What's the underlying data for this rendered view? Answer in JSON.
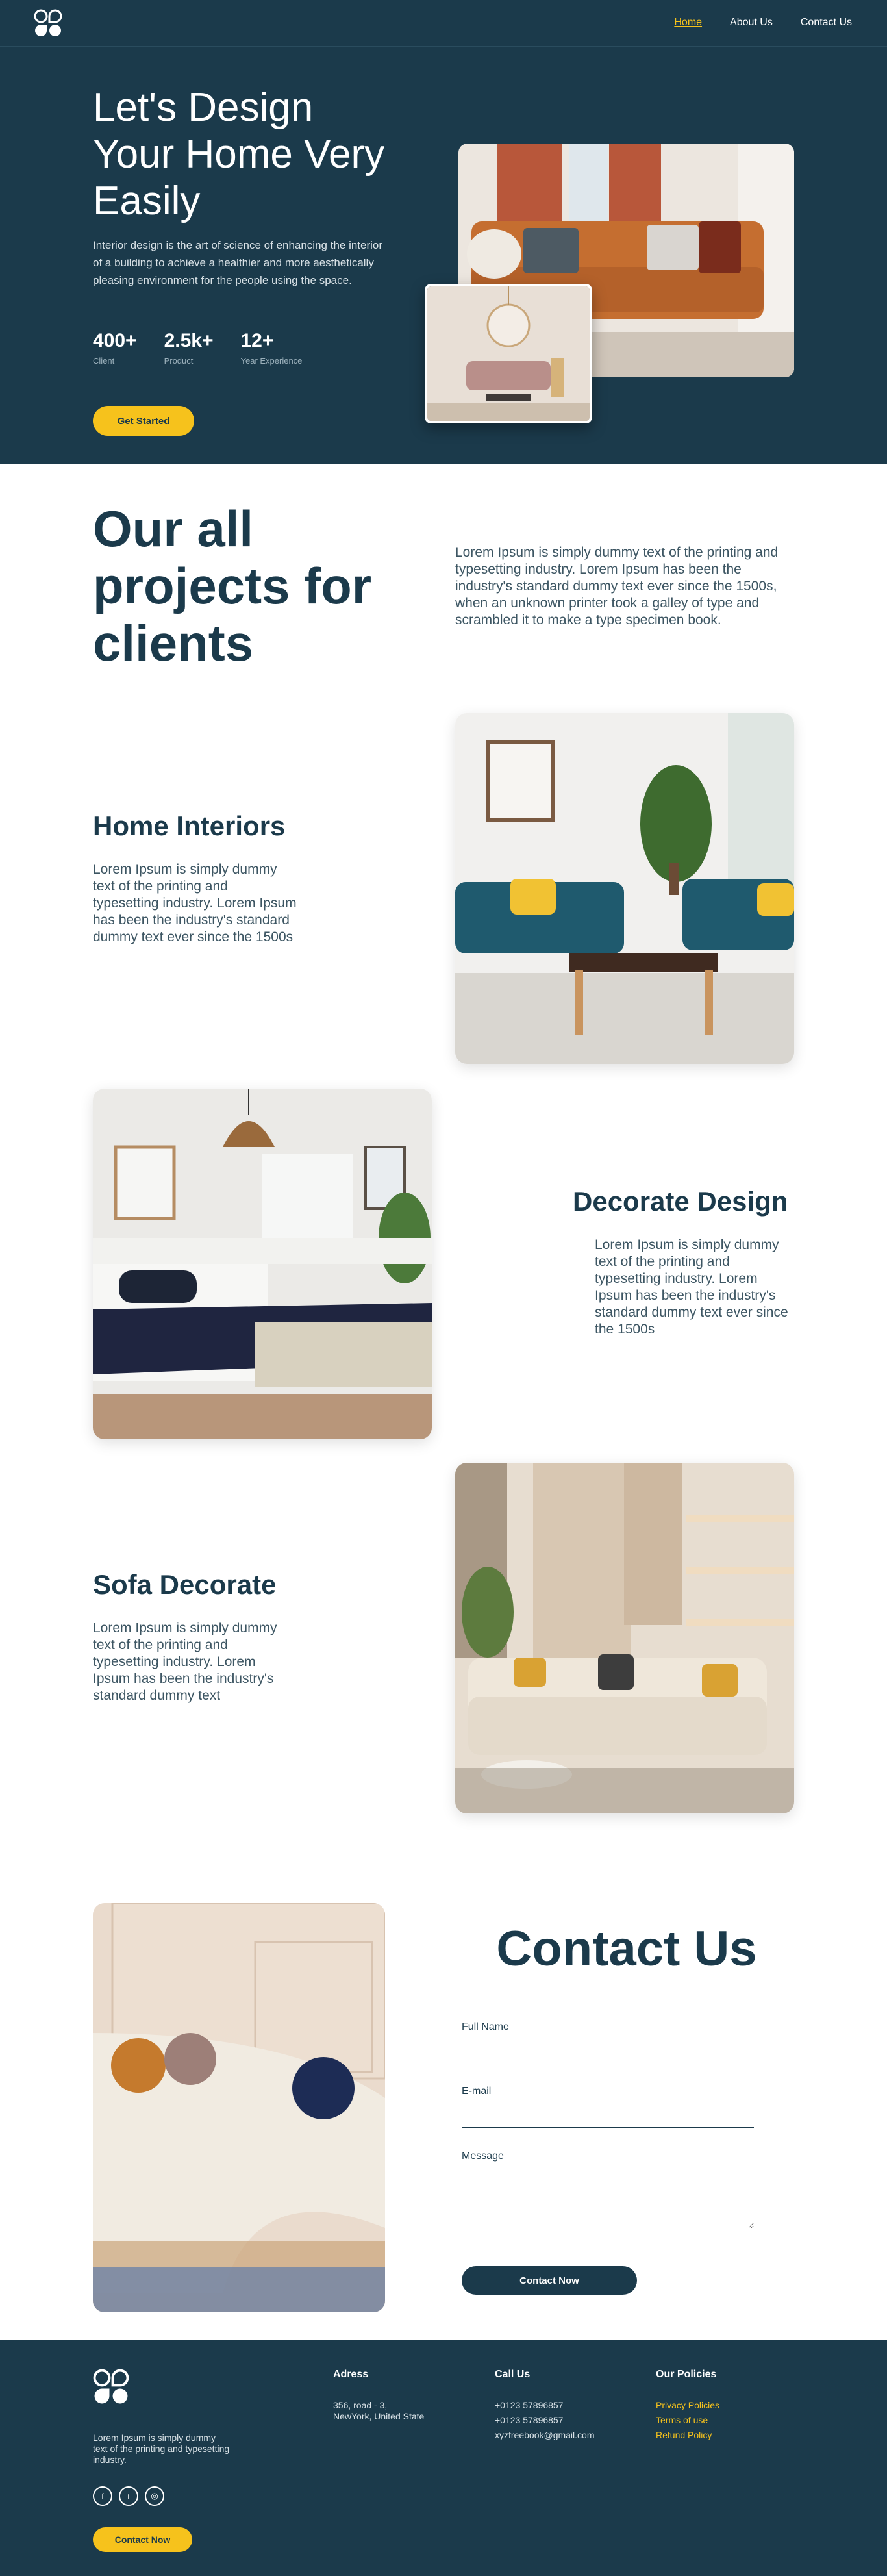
{
  "nav": {
    "logo": "logo-icon",
    "links": [
      "Home",
      "About Us",
      "Contact Us"
    ],
    "active": "Home"
  },
  "hero": {
    "title": "Let's Design Your Home Very Easily",
    "description": "Interior design is the art of science of enhancing the interior of a building to achieve a healthier and more aesthetically pleasing environment for the people using the space.",
    "stats": [
      {
        "value": "400+",
        "label": "Client"
      },
      {
        "value": "2.5k+",
        "label": "Product"
      },
      {
        "value": "12+",
        "label": "Year Experience"
      }
    ],
    "cta": "Get Started"
  },
  "projects": {
    "title": "Our all projects for clients",
    "description": "Lorem Ipsum is simply dummy text of the printing and typesetting industry. Lorem Ipsum has been the industry's standard dummy text ever since the 1500s, when an unknown printer took a galley of type and scrambled it to make a type specimen book."
  },
  "features": [
    {
      "title": "Home Interiors",
      "description": "Lorem Ipsum is simply dummy text of the printing and typesetting industry. Lorem Ipsum has been the industry's standard dummy text ever since the 1500s"
    },
    {
      "title": "Decorate Design",
      "description": "Lorem Ipsum is simply dummy text of the printing and typesetting industry. Lorem Ipsum has been the industry's standard dummy text ever since the 1500s"
    },
    {
      "title": "Sofa Decorate",
      "description": "Lorem Ipsum is simply dummy text of the printing and typesetting industry. Lorem Ipsum has been the industry's standard dummy text"
    }
  ],
  "contact": {
    "title": "Contact Us",
    "fields": {
      "name": "Full Name",
      "email": "E-mail",
      "message": "Message"
    },
    "submit": "Contact Now"
  },
  "footer": {
    "about": "Lorem Ipsum is simply dummy text of the printing and typesetting industry.",
    "cta": "Contact Now",
    "social_icons": [
      "facebook-icon",
      "twitter-icon",
      "instagram-icon"
    ],
    "address": {
      "title": "Adress",
      "lines": [
        "356, road - 3,",
        "NewYork, United State"
      ]
    },
    "call": {
      "title": "Call Us",
      "lines": [
        "+0123 57896857",
        "+0123 57896857",
        "xyzfreebook@gmail.com"
      ]
    },
    "policies": {
      "title": "Our Policies",
      "links": [
        "Privacy Policies",
        "Terms of use",
        "Refund Policy"
      ]
    }
  },
  "colors": {
    "navy": "#1b3a4b",
    "accent": "#f6c21c",
    "white": "#ffffff"
  }
}
